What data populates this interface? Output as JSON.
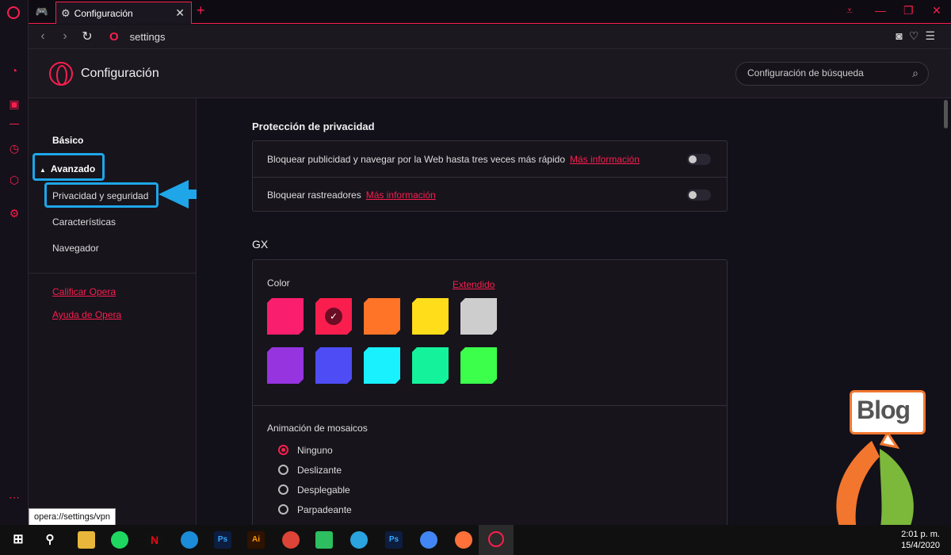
{
  "tab": {
    "title": "Configuración"
  },
  "address": {
    "url": "settings"
  },
  "header": {
    "title": "Configuración",
    "search_placeholder": "Configuración de búsqueda"
  },
  "leftnav": {
    "basic": "Básico",
    "advanced": "Avanzado",
    "privacy": "Privacidad y seguridad",
    "features": "Características",
    "browser": "Navegador",
    "rate": "Calificar Opera",
    "help": "Ayuda de Opera"
  },
  "privacy": {
    "title": "Protección de privacidad",
    "row1": "Bloquear publicidad y navegar por la Web hasta tres veces más rápido",
    "row2": "Bloquear rastreadores",
    "more": "Más información"
  },
  "gx": {
    "title": "GX",
    "color_label": "Color",
    "extended": "Extendido",
    "colors": [
      "#fa1e6e",
      "#fa1e4e",
      "#ff7426",
      "#ffdd1a",
      "#cdcdcd",
      "#9634e0",
      "#4e4cf5",
      "#19f1ff",
      "#14f39c",
      "#3cff4c"
    ],
    "anim_title": "Animación de mosaicos",
    "options": [
      "Ninguno",
      "Deslizante",
      "Desplegable",
      "Parpadeante"
    ]
  },
  "tooltip": "opera://settings/vpn",
  "clock": {
    "time": "2:01 p. m.",
    "date": "15/4/2020"
  },
  "blog": "Blog"
}
